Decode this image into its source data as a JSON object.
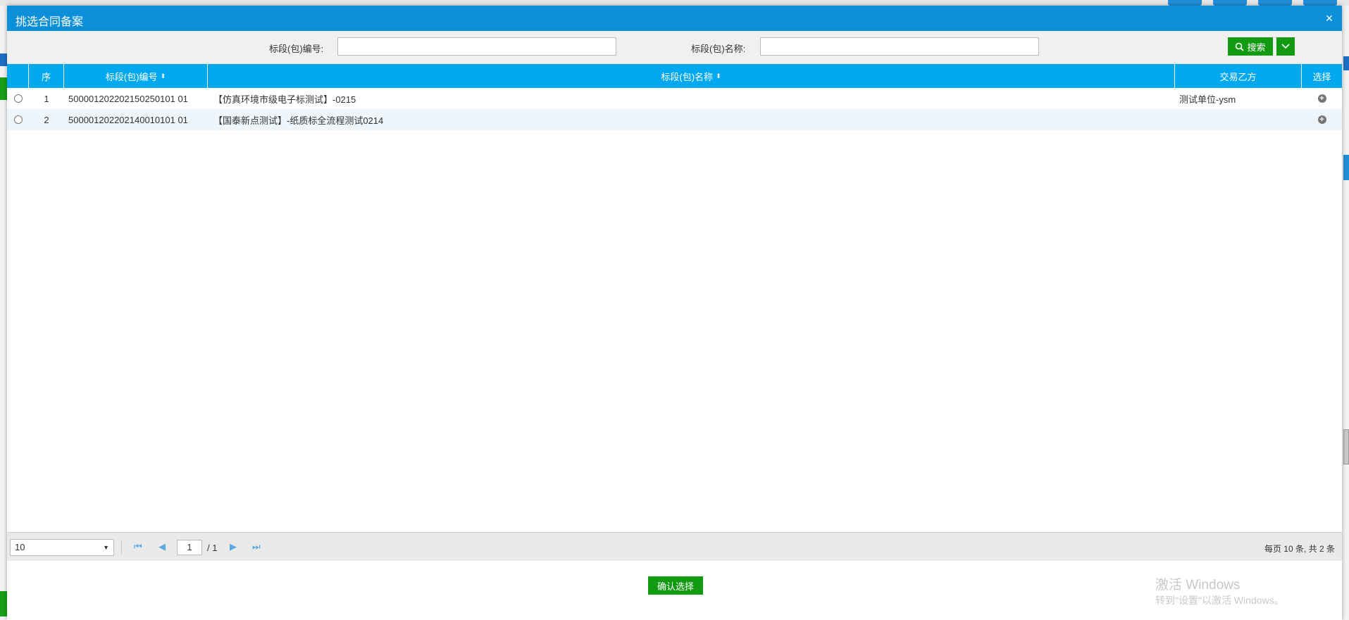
{
  "dialog": {
    "title": "挑选合同备案",
    "close_icon": "×"
  },
  "search": {
    "code_label": "标段(包)编号:",
    "code_value": "",
    "name_label": "标段(包)名称:",
    "name_value": "",
    "search_label": "搜索"
  },
  "grid": {
    "columns": {
      "seq": "序",
      "code": "标段(包)编号",
      "name": "标段(包)名称",
      "party": "交易乙方",
      "select": "选择"
    },
    "rows": [
      {
        "seq": "1",
        "code": "500001202202150250101 01",
        "name": "【仿真环境市级电子标测试】-0215",
        "party": "测试单位-ysm"
      },
      {
        "seq": "2",
        "code": "500001202202140010101 01",
        "name": "【国泰新点测试】-纸质标全流程测试0214",
        "party": ""
      }
    ]
  },
  "pager": {
    "page_size": "10",
    "current_page": "1",
    "total_pages": "/ 1",
    "summary": "每页 10 条, 共 2 条"
  },
  "actions": {
    "confirm_label": "确认选择"
  },
  "watermark": {
    "line1": "激活 Windows",
    "line2": "转到\"设置\"以激活 Windows。"
  }
}
